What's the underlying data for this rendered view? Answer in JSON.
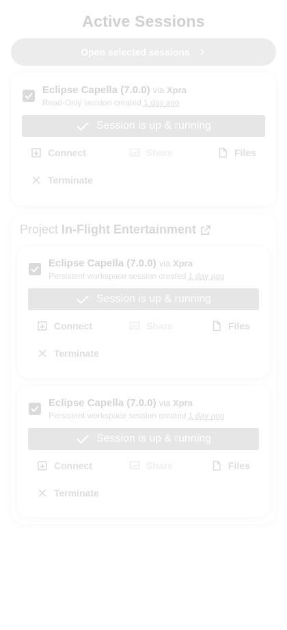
{
  "header": {
    "title": "Active Sessions",
    "open_button_label": "Open selected sessions"
  },
  "sessions": [
    {
      "tool": "Eclipse Capella (7.0.0)",
      "via_prefix": "via",
      "via": "Xpra",
      "subtitle_prefix": "Read-Only session created",
      "created": "1 day ago",
      "status": "Session is up & running",
      "checked": true,
      "actions": {
        "connect": "Connect",
        "share": "Share",
        "files": "Files",
        "terminate": "Terminate"
      }
    },
    {
      "tool": "Eclipse Capella (7.0.0)",
      "via_prefix": "via",
      "via": "Xpra",
      "subtitle_prefix": "Persistent workspace session created",
      "created": "1 day ago",
      "status": "Session is up & running",
      "checked": true,
      "actions": {
        "connect": "Connect",
        "share": "Share",
        "files": "Files",
        "terminate": "Terminate"
      }
    },
    {
      "tool": "Eclipse Capella (7.0.0)",
      "via_prefix": "via",
      "via": "Xpra",
      "subtitle_prefix": "Persistent workspace session created",
      "created": "1 day ago",
      "status": "Session is up & running",
      "checked": true,
      "actions": {
        "connect": "Connect",
        "share": "Share",
        "files": "Files",
        "terminate": "Terminate"
      }
    }
  ],
  "project": {
    "prefix": "Project",
    "name": "In-Flight Entertainment"
  },
  "icons": {
    "open": "chevron-right-icon",
    "project_link": "external-link-icon",
    "checkbox": "checkbox-checked-icon",
    "status": "checkmark-icon",
    "connect": "open-in-new-window-icon",
    "share": "screen-share-icon",
    "files": "file-icon",
    "terminate": "close-icon"
  },
  "colors": {
    "button_bg": "#ececec",
    "status_bg": "#e6e6e6",
    "checkbox": "#dadada"
  }
}
